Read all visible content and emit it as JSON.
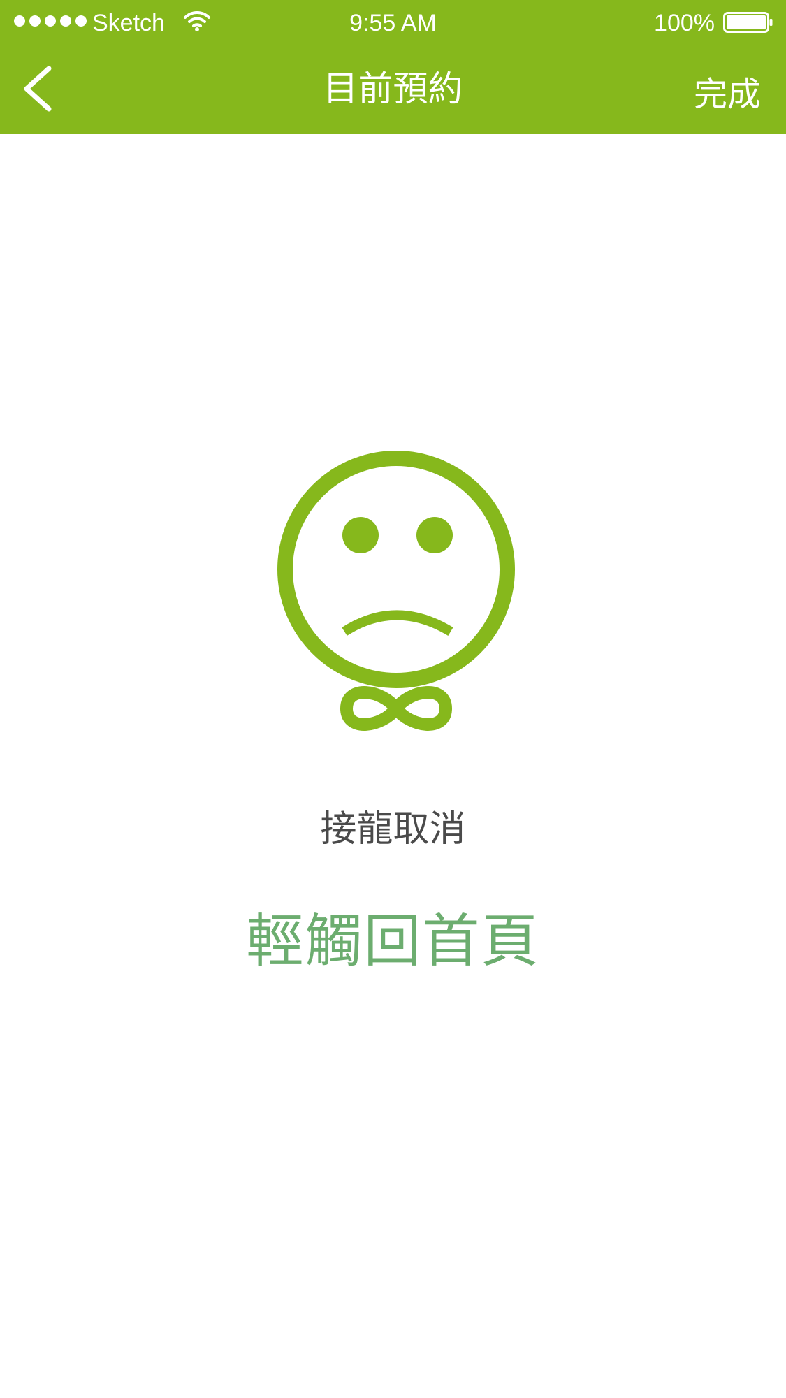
{
  "status_bar": {
    "carrier": "Sketch",
    "time": "9:55 AM",
    "battery_percent": "100%",
    "signal_icon": "signal-dots-icon",
    "wifi_icon": "wifi-icon",
    "battery_icon": "battery-full-icon"
  },
  "nav_bar": {
    "back_icon": "chevron-left-icon",
    "title": "目前預約",
    "done_label": "完成"
  },
  "content": {
    "illustration_icon": "sad-face-icon",
    "message": "接龍取消",
    "home_link": "輕觸回首頁"
  },
  "colors": {
    "brand_green": "#86b81c",
    "link_green": "#6cad6f",
    "text_gray": "#4a4a4a",
    "background": "#ffffff"
  }
}
